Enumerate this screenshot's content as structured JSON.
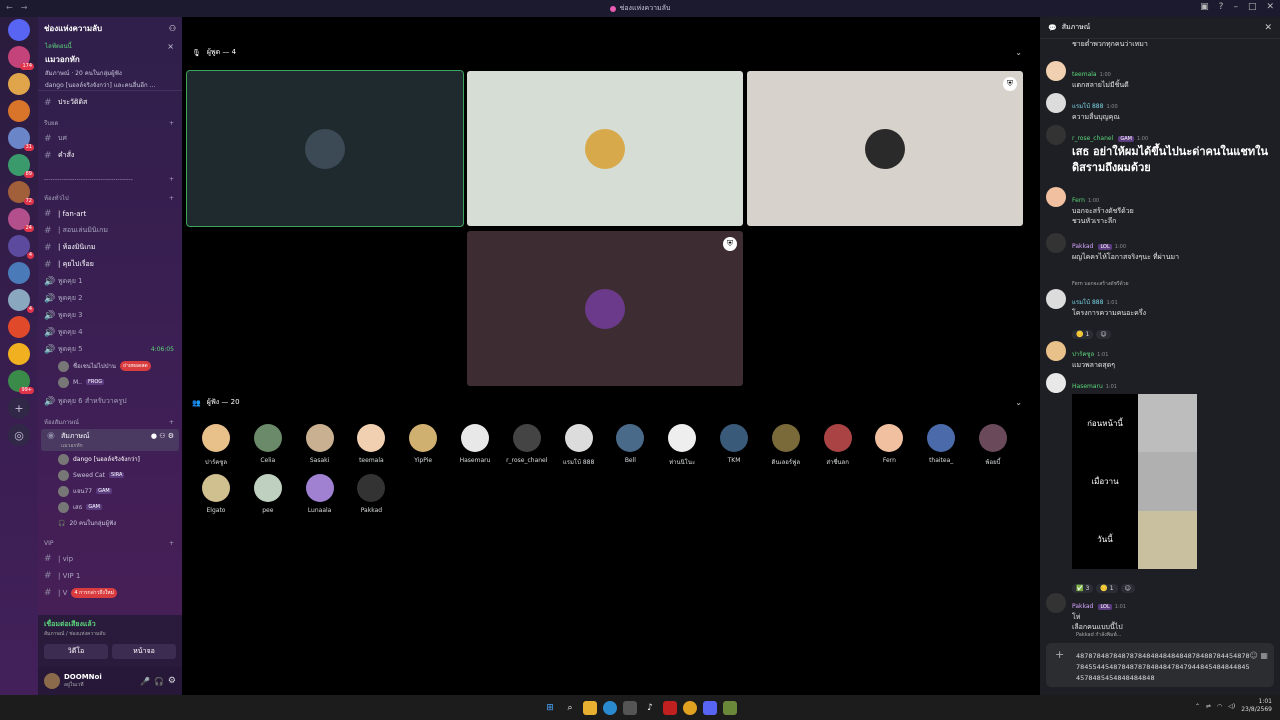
{
  "window": {
    "title": "ช่องแห่งความลับ"
  },
  "servers": [
    {
      "badge": "174",
      "color": "#c3437a"
    },
    {
      "badge": "",
      "color": "#e0a44a"
    },
    {
      "badge": "",
      "color": "#d8752a"
    },
    {
      "badge": "31",
      "color": "#6a86c9"
    },
    {
      "badge": "89",
      "color": "#3a9a6b"
    },
    {
      "badge": "72",
      "color": "#a15f3a"
    },
    {
      "badge": "24",
      "color": "#b34f8a"
    },
    {
      "badge": "4",
      "color": "#5b4a9e"
    },
    {
      "badge": "",
      "color": "#4a7ab8"
    },
    {
      "badge": "4",
      "color": "#8aa7c0"
    },
    {
      "badge": "",
      "color": "#e04a2a"
    },
    {
      "badge": "",
      "color": "#f0b020"
    },
    {
      "badge": "99+",
      "color": "#3a8a4a"
    }
  ],
  "sidebar": {
    "server_name": "ช่องแห่งความลับ",
    "event": {
      "live": "ไลฟ์ตอนนี้",
      "name": "แมวอกหัก",
      "line1": "สัมภาษณ์ · 20 คนในกลุ่มผู้ฟัง",
      "line2": "dango [นอลล์จริงจังกว่า] และคนอื่นอีก ..."
    },
    "ch_history": "ประวัติดิส",
    "cat_rules": "รีบยด",
    "ch_rules1": "บศ",
    "ch_cmds": "คำสั่ง",
    "cat_general": "ห้องทั่วไป",
    "ch_fanart": "| fan-art",
    "ch_tutorial": "| สอนเล่นมินิเกม",
    "ch_minigame": "| ห้องมินิเกม",
    "ch_chat": "| คุยไปเรื่อย",
    "voice": [
      "พูดคุย 1",
      "พูดคุย 2",
      "พูดคุย 3",
      "พูดคุย 4",
      "พูดคุย 5"
    ],
    "voice5_time": "4:06:05",
    "v5_u1": "ชื่อเชนไม่ไปป่าน",
    "v5_u1_tag": "ถ่ายทอดสด",
    "v5_u2": "M..",
    "v5_u2_tag": "FROG",
    "voice6": "พูดคุย 6 สำหรับวาครูป",
    "cat_stage": "ห้องสัมภาษณ์",
    "stage_name": "สัมภาษณ์",
    "stage_sub": "แมวอกหัก",
    "stage_u1": "dango [นอลล์จริงจังกว่า]",
    "stage_u2": "Sweed Cat",
    "stage_u2_tag": "SIRA",
    "stage_u3": "แจน77",
    "stage_u3_tag": "GAM",
    "stage_u4": "เสธ",
    "stage_u4_tag": "GAM",
    "stage_listeners": "20 คนในกลุ่มผู้ฟัง",
    "cat_vip": "VIP",
    "ch_vip": "| vip",
    "ch_vip1": "| VIP 1",
    "ch_vip2": "| V",
    "mention": "4 การกล่าวถึงใหม่",
    "voice_status": "เชื่อมต่อเสียงแล้ว",
    "voice_sub": "สัมภาษณ์ / ช่องแห่งความลับ",
    "btn_video": "วิดีโอ",
    "btn_screen": "หน้าจอ",
    "username": "DOOMNoi",
    "userstatus": "อยู่ในเวที"
  },
  "stage": {
    "speakers_label": "ผู้พูด — 4",
    "audience_label": "ผู้ฟัง — 20",
    "speakers": [
      {
        "bg": "#1e2a2e",
        "av": "#3b4a55",
        "outline": true,
        "shield": false
      },
      {
        "bg": "#d6ddd5",
        "av": "#d8a94a",
        "outline": false,
        "shield": false
      },
      {
        "bg": "#d7d3cc",
        "av": "#2a2a2a",
        "outline": false,
        "shield": true
      },
      {
        "bg": "#3d2d32",
        "av": "#6b3a8a",
        "outline": false,
        "shield": true
      }
    ],
    "audience": [
      {
        "name": "ปาร์คซูล",
        "color": "#e8c08a"
      },
      {
        "name": "Celia",
        "color": "#6a8a6a"
      },
      {
        "name": "Sasaki",
        "color": "#c8b090"
      },
      {
        "name": "teemala",
        "color": "#f0d0b0"
      },
      {
        "name": "YipPie",
        "color": "#d0b070"
      },
      {
        "name": "Hasemaru",
        "color": "#e8e8e8"
      },
      {
        "name": "r_rose_chanel",
        "color": "#444"
      },
      {
        "name": "แรมโบ้ 888",
        "color": "#dcdcdc"
      },
      {
        "name": "Bell",
        "color": "#4a6a8a"
      },
      {
        "name": "ท่านนิโนะ",
        "color": "#eee"
      },
      {
        "name": "TKM",
        "color": "#3a5a7a"
      },
      {
        "name": "ดินเลอร์ฟูล",
        "color": "#7a6a3a"
      },
      {
        "name": "ส่าชื่นลก",
        "color": "#aa4444"
      },
      {
        "name": "Fern",
        "color": "#f0c0a0"
      },
      {
        "name": "thaitea_",
        "color": "#4a6aaa"
      },
      {
        "name": "พ้อยบี้",
        "color": "#6a4a5a"
      },
      {
        "name": "Elgato",
        "color": "#d0c090"
      },
      {
        "name": "pee",
        "color": "#c0d0c0"
      },
      {
        "name": "Lunaala",
        "color": "#a080d0"
      },
      {
        "name": "Pakkad",
        "color": "#333"
      }
    ]
  },
  "chat": {
    "title": "สัมภาษณ์",
    "top_line": "ชายต่ำพวกทุกคนว่าเหมา",
    "m1_name": "teemala",
    "m1_time": "1:00",
    "m1_text": "แตกสลายไม่มีชิ้นดี",
    "m2_name": "แรมโบ้ 888",
    "m2_time": "1:00",
    "m2_text": "ความลื่นบุญคุณ",
    "m3_name": "r_rose_chanel",
    "m3_tag": "GAM",
    "m3_time": "1:00",
    "m3_text": "เสธ อย่าให้ผมได้ขึ้นไปนะด่าคนในแชทในดิสรามถึงผมด้วย",
    "m4_name": "Fern",
    "m4_time": "1:00",
    "m4_text1": "บอกจะสร้างดัชรีด้วย",
    "m4_text2": "ชวนหัวเราะลึก",
    "m5_name": "Pakkad",
    "m5_tag": "LOL",
    "m5_time": "1:00",
    "m5_text": "ผญไคครไห้โอกาสจริงๆนะ ที่ผ่านมา",
    "m6_reply": "Fern บอกจะสร้างดัชรีด้วย",
    "m6_name": "แรมโบ้ 888",
    "m6_time": "1:01",
    "m6_text": "โครงการความคนอะครึ่ง",
    "m6_r1": "1",
    "m7_name": "ปาร์คซูล",
    "m7_time": "1:01",
    "m7_text": "แมวพลาดสุดๆ",
    "m8_name": "Hasemaru",
    "m8_time": "1:01",
    "meme": [
      "ก่อนหน้านี้",
      "เมื่อวาน",
      "วันนี้"
    ],
    "m8_r1": "3",
    "m8_r2": "1",
    "m9_name": "Pakkad",
    "m9_tag": "LOL",
    "m9_time": "1:01",
    "m9_text1": "โห่",
    "m9_text2": "เลือกคนแบบนี้ไป",
    "typing": "Pakkad กำลังพิมพ์...",
    "input": "4878784878487878484848484848784887844548787845544548784878784848478479448454848448454578485454848484848"
  },
  "taskbar": {
    "time": "1:01",
    "date": "23/8/2569"
  }
}
